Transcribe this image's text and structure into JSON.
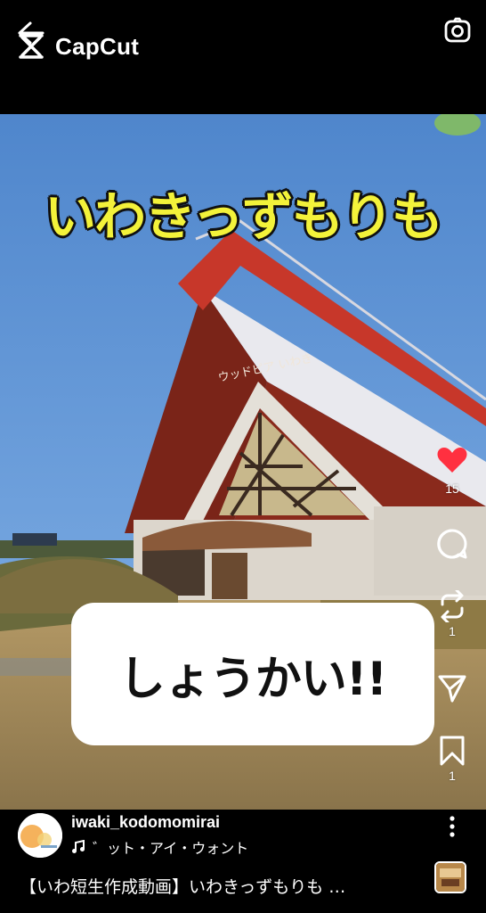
{
  "app": {
    "logo_text": "CapCut"
  },
  "video": {
    "title_overlay": "いわきっずもりも",
    "building_sign": "ウッドピア いわき",
    "caption": "しょうかい!!"
  },
  "actions": {
    "like_count": "15",
    "repost_count": "1",
    "save_count": "1"
  },
  "post": {
    "username": "iwaki_kodomomirai",
    "music": "゛ット・アイ・ウォント",
    "description": "【いわ短生作成動画】いわきっずもりも …"
  },
  "colors": {
    "like": "#ff3040",
    "overlay_title": "#f3f23a",
    "sky": "#5a8fd0",
    "roof": "#8a2a1c"
  }
}
